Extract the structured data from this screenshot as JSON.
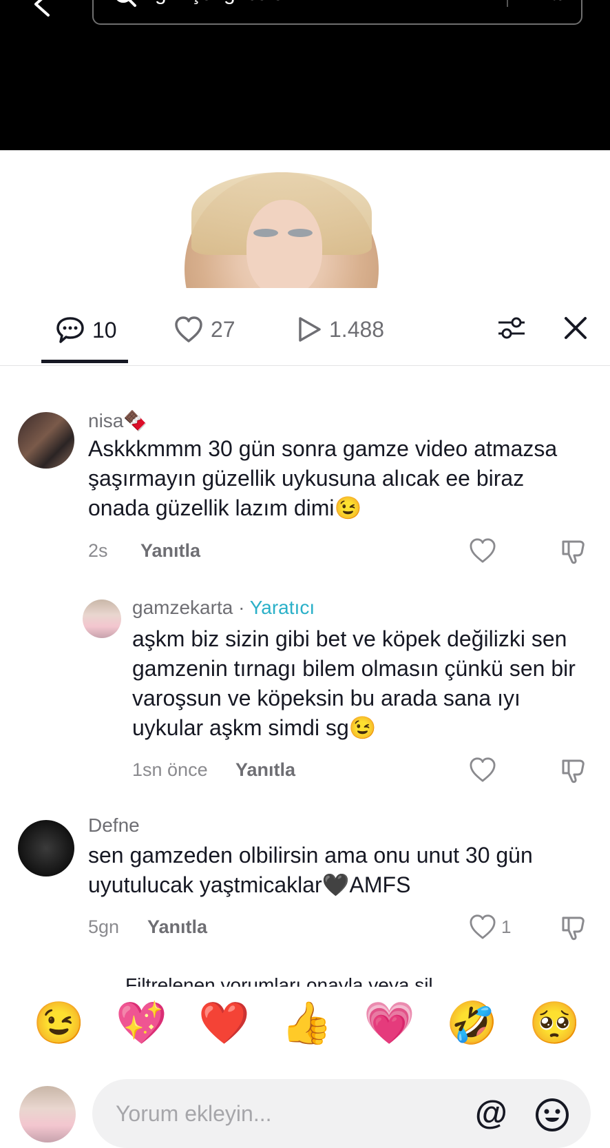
{
  "search": {
    "placeholder": "İlgili içeriği bulun",
    "button_label": "Ara"
  },
  "stats": {
    "comments": "10",
    "likes": "27",
    "plays": "1.488"
  },
  "comments": [
    {
      "username": "nisa🍫",
      "text": "Askkkmmm 30 gün sonra gamze video atmazsa şaşırmayın güzellik uykusuna alıcak ee biraz onada güzellik lazım dimi😉",
      "time": "2s",
      "reply_label": "Yanıtla",
      "likes": ""
    },
    {
      "username": "gamzekarta",
      "separator": "·",
      "badge": "Yaratıcı",
      "text": "aşkm biz sizin gibi bet ve köpek değilizki sen gamzenin tırnagı bilem olmasın çünkü sen bir varoşsun ve köpeksin bu arada sana ıyı uykular aşkm simdi sg😉",
      "time": "1sn önce",
      "reply_label": "Yanıtla",
      "likes": ""
    },
    {
      "username": "Defne",
      "text": "sen gamzeden olbilirsin ama onu unut 30 gün uyutulucak yaştmicaklar🖤AMFS",
      "time": "5gn",
      "reply_label": "Yanıtla",
      "likes": "1"
    }
  ],
  "filtered_label": "Filtrelenen yorumları onayla veya sil",
  "emojis": [
    "😉",
    "💖",
    "❤️",
    "👍",
    "💗",
    "🤣",
    "🥺"
  ],
  "input": {
    "placeholder": "Yorum ekleyin...",
    "at_symbol": "@"
  },
  "colors": {
    "accent_creator": "#2ab0c8",
    "text_primary": "#161823",
    "text_secondary": "#8a8a8e"
  }
}
